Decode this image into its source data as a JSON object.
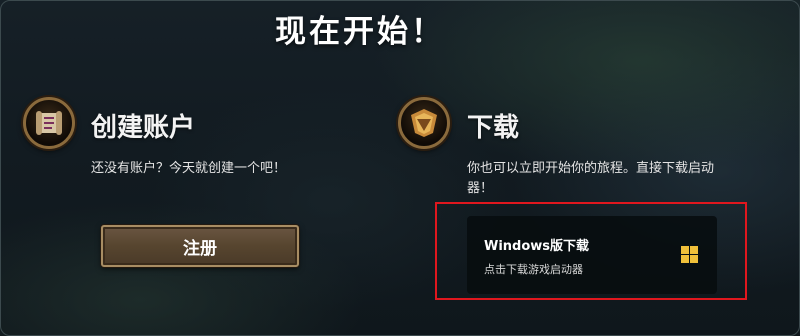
{
  "header": {
    "title": "现在开始！"
  },
  "create_account": {
    "icon": "scroll-icon",
    "title": "创建账户",
    "description": "还没有账户？今天就创建一个吧！",
    "button_label": "注册"
  },
  "download": {
    "icon": "download-shield-icon",
    "title": "下载",
    "description_line1": "你也可以立即开始你的旅程。直接下载启动",
    "description_line2": "器！",
    "card": {
      "title": "Windows版下载",
      "subtitle": "点击下载游戏启动器",
      "icon": "windows-icon"
    }
  },
  "colors": {
    "highlight": "#e0171e",
    "button": "#57452f",
    "windows_logo": "#f0c03a",
    "badge_ring": "#8a6a3c"
  }
}
